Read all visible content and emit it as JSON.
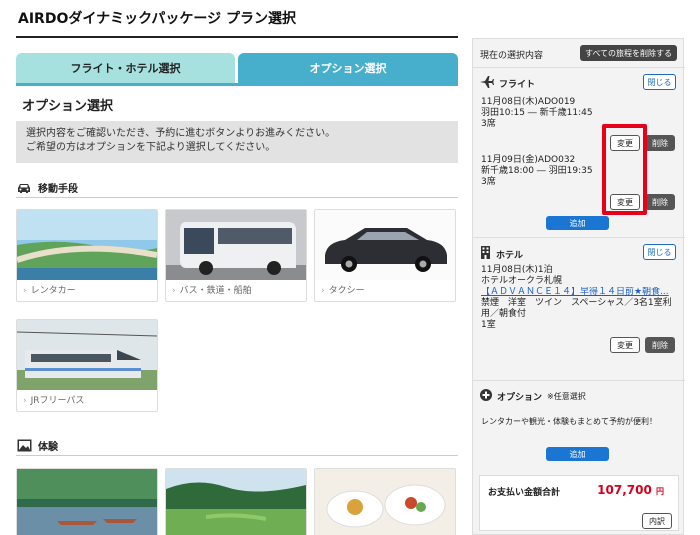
{
  "page": {
    "title": "AIRDOダイナミックパッケージ プラン選択"
  },
  "tabs": [
    {
      "label": "フライト・ホテル選択"
    },
    {
      "label": "オプション選択"
    }
  ],
  "main": {
    "heading": "オプション選択",
    "info_line1": "選択内容をご確認いただき、予約に進むボタンよりお進みください。",
    "info_line2": "ご希望の方はオプションを下記より選択してください。",
    "transport": {
      "heading": "移動手段",
      "cards": [
        {
          "label": "レンタカー"
        },
        {
          "label": "バス・鉄道・船舶"
        },
        {
          "label": "タクシー"
        },
        {
          "label": "JRフリーパス"
        }
      ]
    },
    "experience": {
      "heading": "体験"
    }
  },
  "side": {
    "header": "現在の選択内容",
    "delete_all": "すべての旅程を削除する",
    "flight": {
      "title": "フライト",
      "close": "閉じる",
      "legs": [
        {
          "line1": "11月08日(木)ADO019",
          "line2": "羽田10:15 ― 新千歳11:45",
          "line3": "3席"
        },
        {
          "line1": "11月09日(金)ADO032",
          "line2": "新千歳18:00 ― 羽田19:35",
          "line3": "3席"
        }
      ],
      "change": "変更",
      "delete": "削除",
      "add": "追加"
    },
    "hotel": {
      "title": "ホテル",
      "close": "閉じる",
      "line1": "11月08日(木)1泊",
      "line2": "ホテルオークラ札幌",
      "line3": "【ＡＤＶＡＮＣＥ１４】早得１４日前★朝食...",
      "line4": "禁煙　洋室　ツイン　スペーシャス／3名1室利",
      "line5": "用／朝食付",
      "line6": "1室",
      "change": "変更",
      "delete": "削除"
    },
    "option": {
      "title": "オプション",
      "note": "※任意選択",
      "promo": "レンタカーや観光・体験もまとめて予約が便利！",
      "add": "追加"
    },
    "total": {
      "label": "お支払い金額合計",
      "amount": "107,700",
      "unit": "円",
      "breakdown": "内訳"
    }
  },
  "colors": {
    "tab_inactive": "#a6e0df",
    "tab_active": "#47aecc",
    "add_button": "#1a75d3",
    "price": "#d6001c",
    "highlight": "#e6001a"
  },
  "icons": [
    "car-icon",
    "photo-icon",
    "airplane-icon",
    "building-icon",
    "plus-circle-icon"
  ]
}
